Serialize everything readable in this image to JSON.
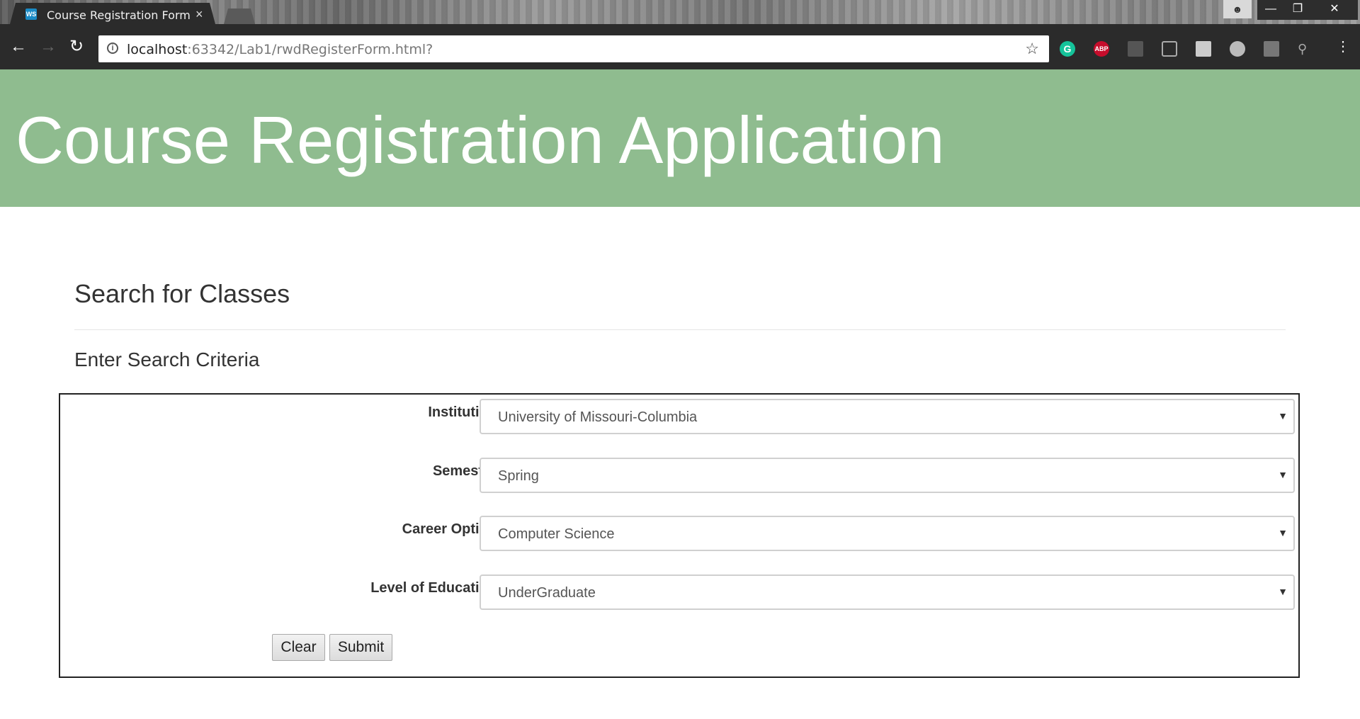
{
  "browser": {
    "tab_title": "Course Registration Form",
    "favicon_text": "WS",
    "url_host": "localhost",
    "url_rest": ":63342/Lab1/rwdRegisterForm.html?",
    "extensions": [
      "grammarly-icon",
      "adblock-plus-icon",
      "pdf-icon",
      "reader-icon",
      "shield-icon",
      "cloud-icon",
      "wand-icon",
      "search-icon"
    ],
    "abp_text": "ABP",
    "grammarly_text": "G"
  },
  "page": {
    "banner_title": "Course Registration Application",
    "section_title": "Search for Classes",
    "sub_title": "Enter Search Criteria"
  },
  "form": {
    "fields": [
      {
        "label": "Institution",
        "value": "University of Missouri-Columbia"
      },
      {
        "label": "Semester",
        "value": "Spring"
      },
      {
        "label": "Career Option",
        "value": "Computer Science"
      },
      {
        "label": "Level of Education",
        "value": "UnderGraduate"
      }
    ],
    "clear_label": "Clear",
    "submit_label": "Submit"
  },
  "colors": {
    "banner": "#8fbc8f",
    "chrome_dark": "#2b2b2b"
  }
}
